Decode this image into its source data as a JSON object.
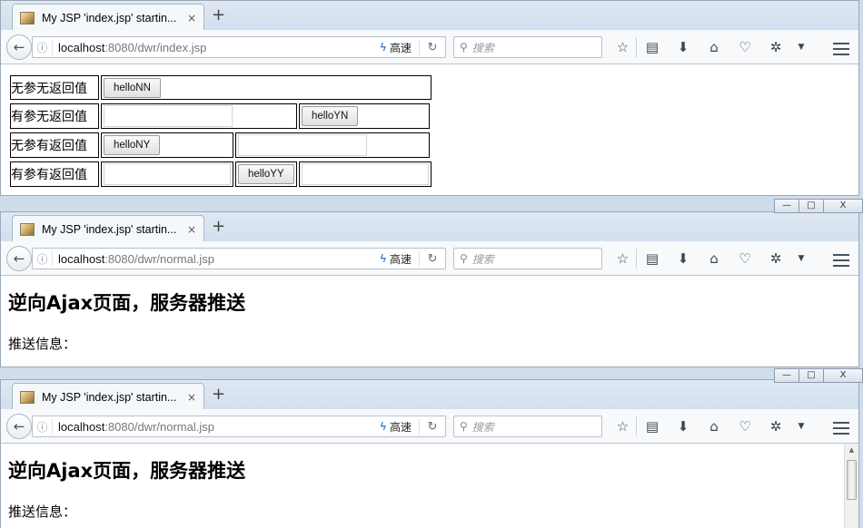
{
  "browser": {
    "search_placeholder": "搜索",
    "speed_label": "高速",
    "new_tab": "+",
    "tab_close": "×",
    "window_controls": {
      "minimize": "—",
      "restore": "□",
      "close": "X"
    }
  },
  "window1": {
    "tab_title": "My JSP 'index.jsp' startin...",
    "url_host": "localhost",
    "url_path": ":8080/dwr/index.jsp",
    "rows": [
      {
        "label": "无参无返回值",
        "button": "helloNN"
      },
      {
        "label": "有参无返回值",
        "button": "helloYN"
      },
      {
        "label": "无参有返回值",
        "button": "helloNY"
      },
      {
        "label": "有参有返回值",
        "button": "helloYY"
      }
    ]
  },
  "window2": {
    "tab_title": "My JSP 'index.jsp' startin...",
    "url_host": "localhost",
    "url_path": ":8080/dwr/normal.jsp",
    "heading": "逆向Ajax页面，服务器推送",
    "push_label": "推送信息："
  },
  "window3": {
    "tab_title": "My JSP 'index.jsp' startin...",
    "url_host": "localhost",
    "url_path": ":8080/dwr/normal.jsp",
    "heading": "逆向Ajax页面，服务器推送",
    "push_label": "推送信息："
  }
}
